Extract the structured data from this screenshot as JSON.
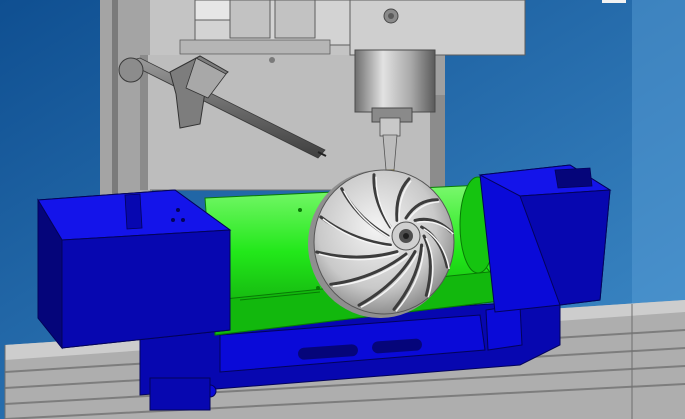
{
  "viewport": {
    "background_top": "#0f4f91",
    "background_bottom": "#3f8cc9",
    "colors": {
      "fixture_blue": "#0a0ad8",
      "fixture_blue_dark": "#05057a",
      "fixture_blue_mid": "#0707b0",
      "cradle_green": "#22e81a",
      "cradle_green_dark": "#0e9a0a",
      "cradle_green_light": "#7cf86f",
      "machine_gray": "#b9b9b9",
      "machine_gray_dark": "#6e6e6e",
      "machine_gray_light": "#e2e2e2",
      "table_gray": "#a8a8a8",
      "part_silver": "#d6d6d6",
      "tool_gold": "#d9b21a"
    },
    "impeller_blades": 12
  }
}
